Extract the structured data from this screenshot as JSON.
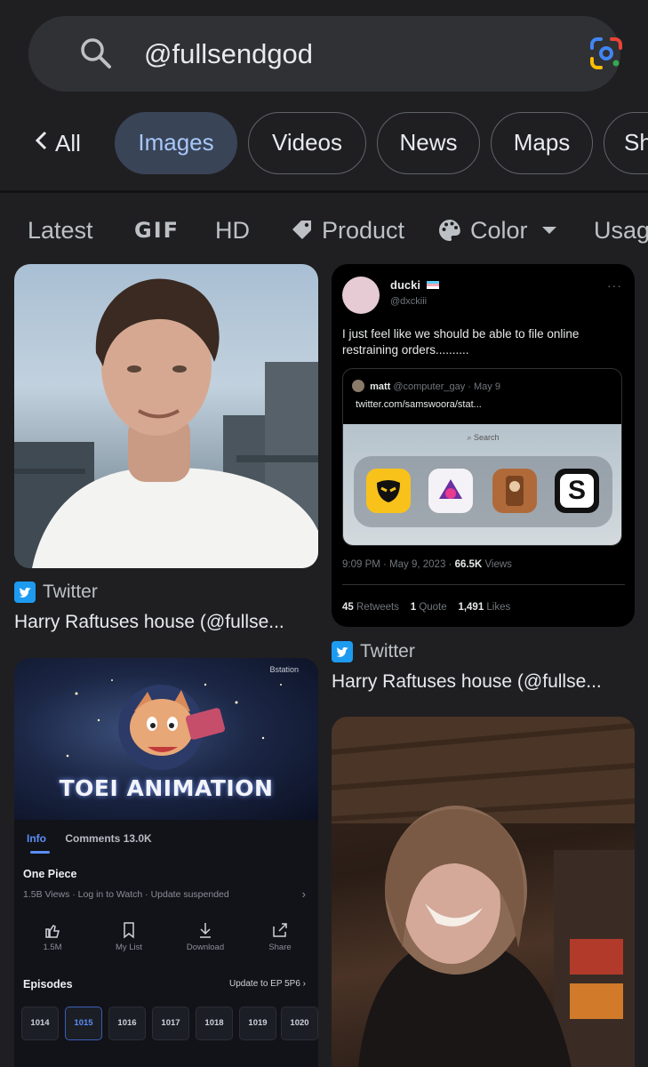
{
  "search": {
    "query": "@fullsendgod"
  },
  "tabs": {
    "all": "All",
    "items": [
      "Images",
      "Videos",
      "News",
      "Maps",
      "Sh"
    ]
  },
  "filters": [
    "Latest",
    "GIF",
    "HD",
    "Product",
    "Color",
    "Usag"
  ],
  "results": [
    {
      "source": "Twitter",
      "title": "Harry Raftuses house (@fullse..."
    },
    {
      "source": "Twitter",
      "title": "Harry Raftuses house (@fullse..."
    }
  ],
  "tweet": {
    "name": "ducki",
    "handle": "@dxckiii",
    "more": "···",
    "body": "I just feel like we should be able to file online restraining orders..........",
    "quote_user": "matt",
    "quote_handle": "@computer_gay · May 9",
    "quote_link": "twitter.com/samswoora/stat...",
    "quote_search": "Search",
    "time": "9:09 PM · May 9, 2023 · ",
    "views_count": "66.5K",
    "views_label": " Views",
    "retweets_count": "45",
    "retweets_label": " Retweets",
    "quotes_count": "1",
    "quotes_label": " Quote",
    "likes_count": "1,491",
    "likes_label": " Likes",
    "app_s": "S"
  },
  "anime": {
    "banner_text": "TOEI ANIMATION",
    "corner_text": "Bstation",
    "tab_info": "Info",
    "tab_comments": "Comments 13.0K",
    "title": "One Piece",
    "meta": "1.5B Views · Log in to Watch · Update suspended",
    "actions": [
      "1.5M",
      "My List",
      "Download",
      "Share"
    ],
    "episodes_label": "Episodes",
    "update_label": "Update to EP 5P6",
    "episodes": [
      "1014",
      "1015",
      "1016",
      "1017",
      "1018",
      "1019",
      "1020"
    ]
  },
  "colors": {
    "background": "#1f1f21",
    "search_bg": "#303134",
    "active_tab_bg": "#394457",
    "active_tab_text": "#a8c7fa",
    "twitter_blue": "#1d9bf0"
  }
}
